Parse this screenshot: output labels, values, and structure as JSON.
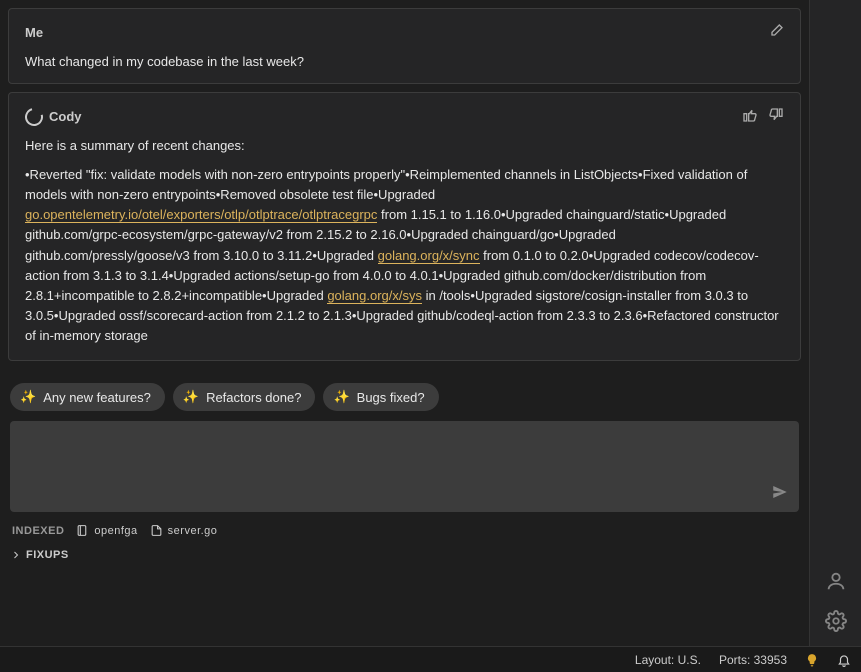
{
  "user": {
    "author": "Me",
    "message": "What changed in my codebase in the last week?"
  },
  "assistant": {
    "author": "Cody",
    "intro": "Here is a summary of recent changes:",
    "segments": [
      {
        "t": "text",
        "v": "•Reverted \"fix: validate models with non-zero entrypoints properly\"•Reimplemented channels in ListObjects•Fixed validation of models with non-zero entrypoints•Removed obsolete test file•Upgraded "
      },
      {
        "t": "link",
        "v": "go.opentelemetry.io/otel/exporters/otlp/otlptrace/otlptracegrpc"
      },
      {
        "t": "text",
        "v": " from 1.15.1 to 1.16.0•Upgraded chainguard/static•Upgraded github.com/grpc-ecosystem/grpc-gateway/v2 from 2.15.2 to 2.16.0•Upgraded chainguard/go•Upgraded github.com/pressly/goose/v3 from 3.10.0 to 3.11.2•Upgraded "
      },
      {
        "t": "link",
        "v": "golang.org/x/sync"
      },
      {
        "t": "text",
        "v": " from 0.1.0 to 0.2.0•Upgraded codecov/codecov-action from 3.1.3 to 3.1.4•Upgraded actions/setup-go from 4.0.0 to 4.0.1•Upgraded github.com/docker/distribution from 2.8.1+incompatible to 2.8.2+incompatible•Upgraded "
      },
      {
        "t": "link",
        "v": "golang.org/x/sys"
      },
      {
        "t": "text",
        "v": " in /tools•Upgraded sigstore/cosign-installer from 3.0.3 to 3.0.5•Upgraded ossf/scorecard-action from 2.1.2 to 2.1.3•Upgraded github/codeql-action from 2.3.3 to 2.3.6•Refactored constructor of in-memory storage"
      }
    ]
  },
  "suggestions": [
    "Any new features?",
    "Refactors done?",
    "Bugs fixed?"
  ],
  "input": {
    "placeholder": ""
  },
  "indexed": {
    "label": "INDEXED",
    "items": [
      "openfga",
      "server.go"
    ]
  },
  "fixups": {
    "label": "FIXUPS"
  },
  "statusbar": {
    "layout": "Layout: U.S.",
    "ports": "Ports: 33953"
  }
}
